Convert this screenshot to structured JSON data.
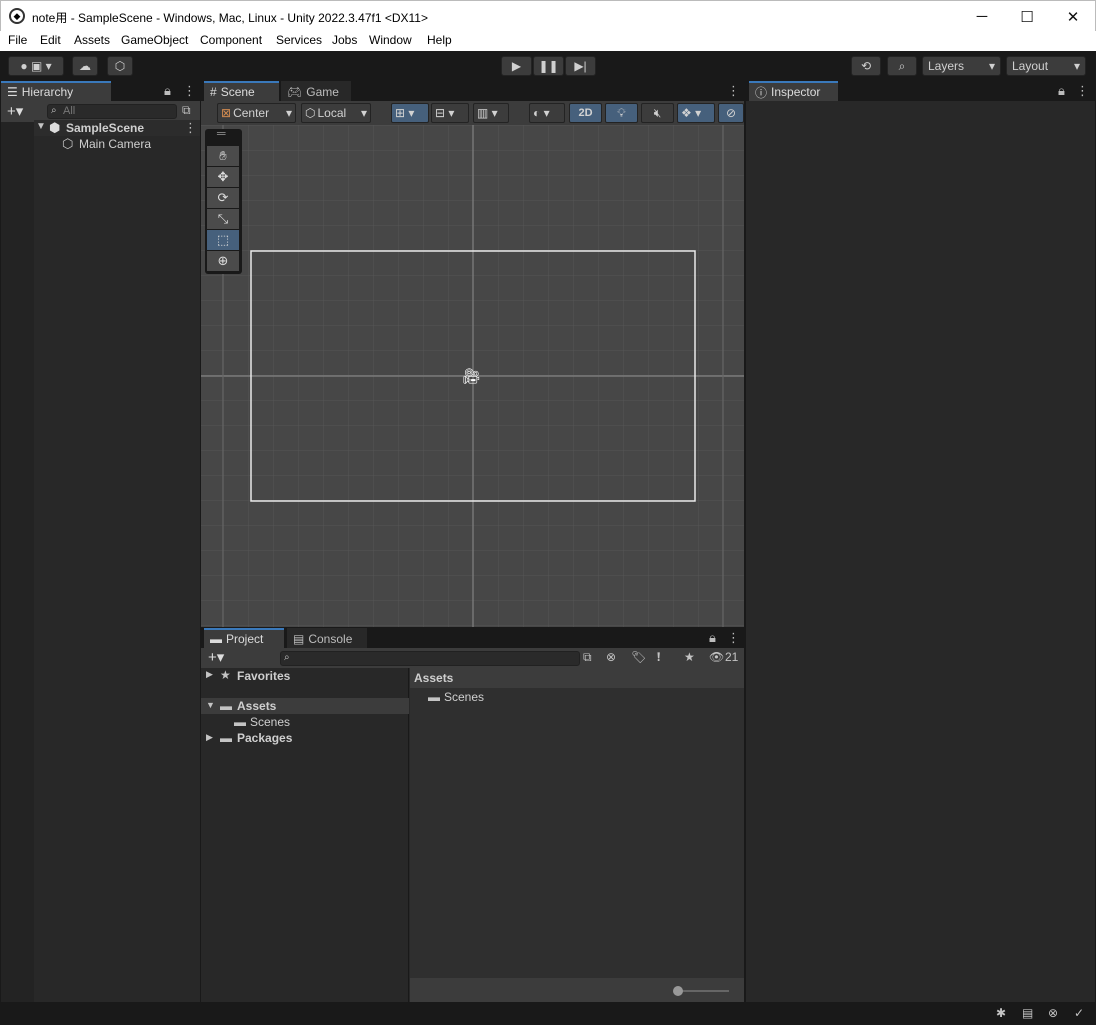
{
  "window": {
    "title": "note用 - SampleScene - Windows, Mac, Linux - Unity 2022.3.47f1 <DX11>",
    "minimize": "─",
    "maximize": "☐",
    "close": "✕"
  },
  "menu": [
    "File",
    "Edit",
    "Assets",
    "GameObject",
    "Component",
    "Services",
    "Jobs",
    "Window",
    "Help"
  ],
  "toolbar": {
    "layers_label": "Layers",
    "layout_label": "Layout"
  },
  "hierarchy": {
    "tab": "Hierarchy",
    "search_placeholder": "All",
    "scene": "SampleScene",
    "items": [
      "Main Camera"
    ]
  },
  "scene": {
    "tabs": [
      "Scene",
      "Game"
    ],
    "pivot": "Center",
    "space": "Local",
    "mode_2d": "2D"
  },
  "project": {
    "tabs": [
      "Project",
      "Console"
    ],
    "hidden_count": "21",
    "tree": {
      "favorites": "Favorites",
      "assets": "Assets",
      "scenes": "Scenes",
      "packages": "Packages"
    },
    "breadcrumb": "Assets",
    "content": [
      "Scenes"
    ]
  },
  "inspector": {
    "tab": "Inspector"
  },
  "colors": {
    "accent": "#3a79bb",
    "panel": "#282828",
    "tab_active": "#3c3c3c",
    "scene_bg": "#474747"
  }
}
